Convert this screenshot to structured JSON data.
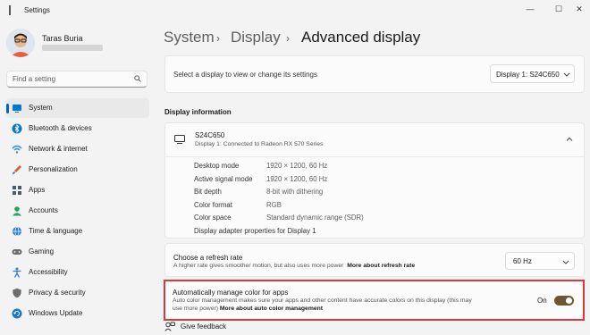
{
  "window": {
    "title": "Settings",
    "controls": [
      "—",
      "☐",
      "✕"
    ]
  },
  "user": {
    "name": "Taras Buria"
  },
  "search": {
    "placeholder": "Find a setting"
  },
  "sidebar": {
    "items": [
      {
        "label": "System",
        "icon": "monitor-icon",
        "color": "#0078d4",
        "active": true
      },
      {
        "label": "Bluetooth & devices",
        "icon": "bluetooth-icon",
        "color": "#0078d4"
      },
      {
        "label": "Network & internet",
        "icon": "wifi-icon",
        "color": "#2f8fd8"
      },
      {
        "label": "Personalization",
        "icon": "brush-icon",
        "color": "#c46b3a"
      },
      {
        "label": "Apps",
        "icon": "apps-icon",
        "color": "#4a5a6a"
      },
      {
        "label": "Accounts",
        "icon": "person-icon",
        "color": "#2aa35a"
      },
      {
        "label": "Time & language",
        "icon": "globe-clock-icon",
        "color": "#2b7fd6"
      },
      {
        "label": "Gaming",
        "icon": "gamepad-icon",
        "color": "#6d6d6d"
      },
      {
        "label": "Accessibility",
        "icon": "accessibility-icon",
        "color": "#2b7fd6"
      },
      {
        "label": "Privacy & security",
        "icon": "shield-icon",
        "color": "#6d6d6d"
      },
      {
        "label": "Windows Update",
        "icon": "update-icon",
        "color": "#1a78c6"
      }
    ]
  },
  "breadcrumb": {
    "items": [
      "System",
      "Display",
      "Advanced display"
    ],
    "separator": "›"
  },
  "select_display": {
    "label": "Select a display to view or change its settings",
    "value": "Display 1: S24C650"
  },
  "display_info": {
    "heading": "Display information",
    "name": "S24C650",
    "subtitle": "Display 1: Connected to Radeon RX 570 Series",
    "rows": [
      {
        "label": "Desktop mode",
        "value": "1920 × 1200, 60 Hz"
      },
      {
        "label": "Active signal mode",
        "value": "1920 × 1200, 60 Hz"
      },
      {
        "label": "Bit depth",
        "value": "8-bit with dithering"
      },
      {
        "label": "Color format",
        "value": "RGB"
      },
      {
        "label": "Color space",
        "value": "Standard dynamic range (SDR)"
      }
    ],
    "adapter_link": "Display adapter properties for Display 1"
  },
  "refresh_rate": {
    "title": "Choose a refresh rate",
    "description": "A higher rate gives smoother motion, but also uses more power",
    "link": "More about refresh rate",
    "value": "60 Hz"
  },
  "color_mgmt": {
    "title": "Automatically manage color for apps",
    "description_line1": "Auto color management makes sure your apps and other content have accurate colors on this display (this may",
    "description_line2": "use more power)",
    "link": "More about auto color management",
    "toggle_label": "On",
    "toggle_on": true
  },
  "feedback": {
    "label": "Give feedback"
  }
}
